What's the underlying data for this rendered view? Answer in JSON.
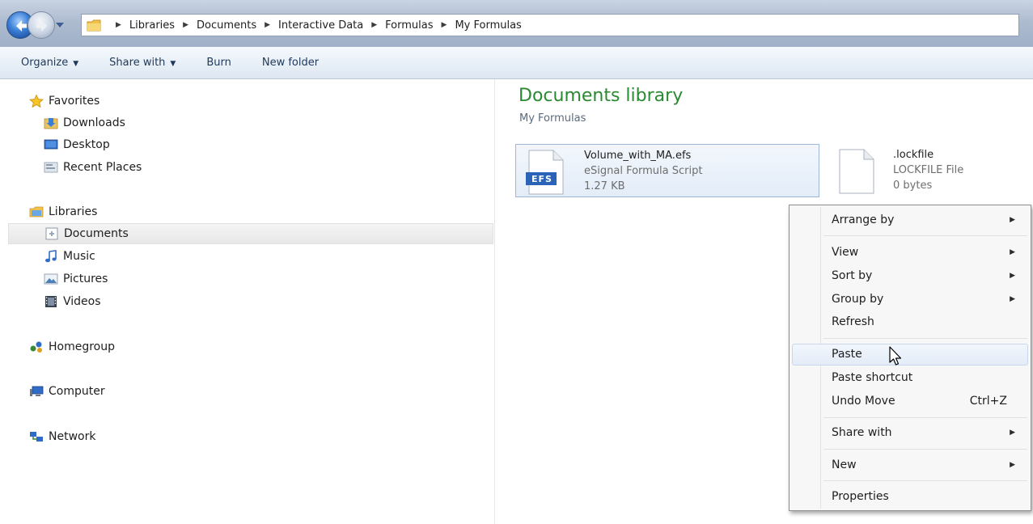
{
  "address_bar": {
    "breadcrumbs": [
      "Libraries",
      "Documents",
      "Interactive Data",
      "Formulas",
      "My Formulas"
    ]
  },
  "toolbar": {
    "organize": "Organize",
    "share_with": "Share with",
    "burn": "Burn",
    "new_folder": "New folder"
  },
  "nav": {
    "favorites": "Favorites",
    "downloads": "Downloads",
    "desktop": "Desktop",
    "recent_places": "Recent Places",
    "libraries": "Libraries",
    "documents": "Documents",
    "music": "Music",
    "pictures": "Pictures",
    "videos": "Videos",
    "homegroup": "Homegroup",
    "computer": "Computer",
    "network": "Network"
  },
  "content": {
    "title": "Documents library",
    "subtitle": "My Formulas",
    "files": [
      {
        "name": "Volume_with_MA.efs",
        "type": "eSignal Formula Script",
        "size": "1.27 KB",
        "badge": "EFS"
      },
      {
        "name": ".lockfile",
        "type": "LOCKFILE File",
        "size": "0 bytes"
      }
    ]
  },
  "context_menu": {
    "arrange_by": "Arrange by",
    "view": "View",
    "sort_by": "Sort by",
    "group_by": "Group by",
    "refresh": "Refresh",
    "paste": "Paste",
    "paste_shortcut": "Paste shortcut",
    "undo_move": "Undo Move",
    "undo_shortcut": "Ctrl+Z",
    "share_with": "Share with",
    "new": "New",
    "properties": "Properties"
  },
  "colors": {
    "library_title": "#2a8a31",
    "command_text": "#1e395b",
    "menu_hover": "#e3ecf8"
  }
}
